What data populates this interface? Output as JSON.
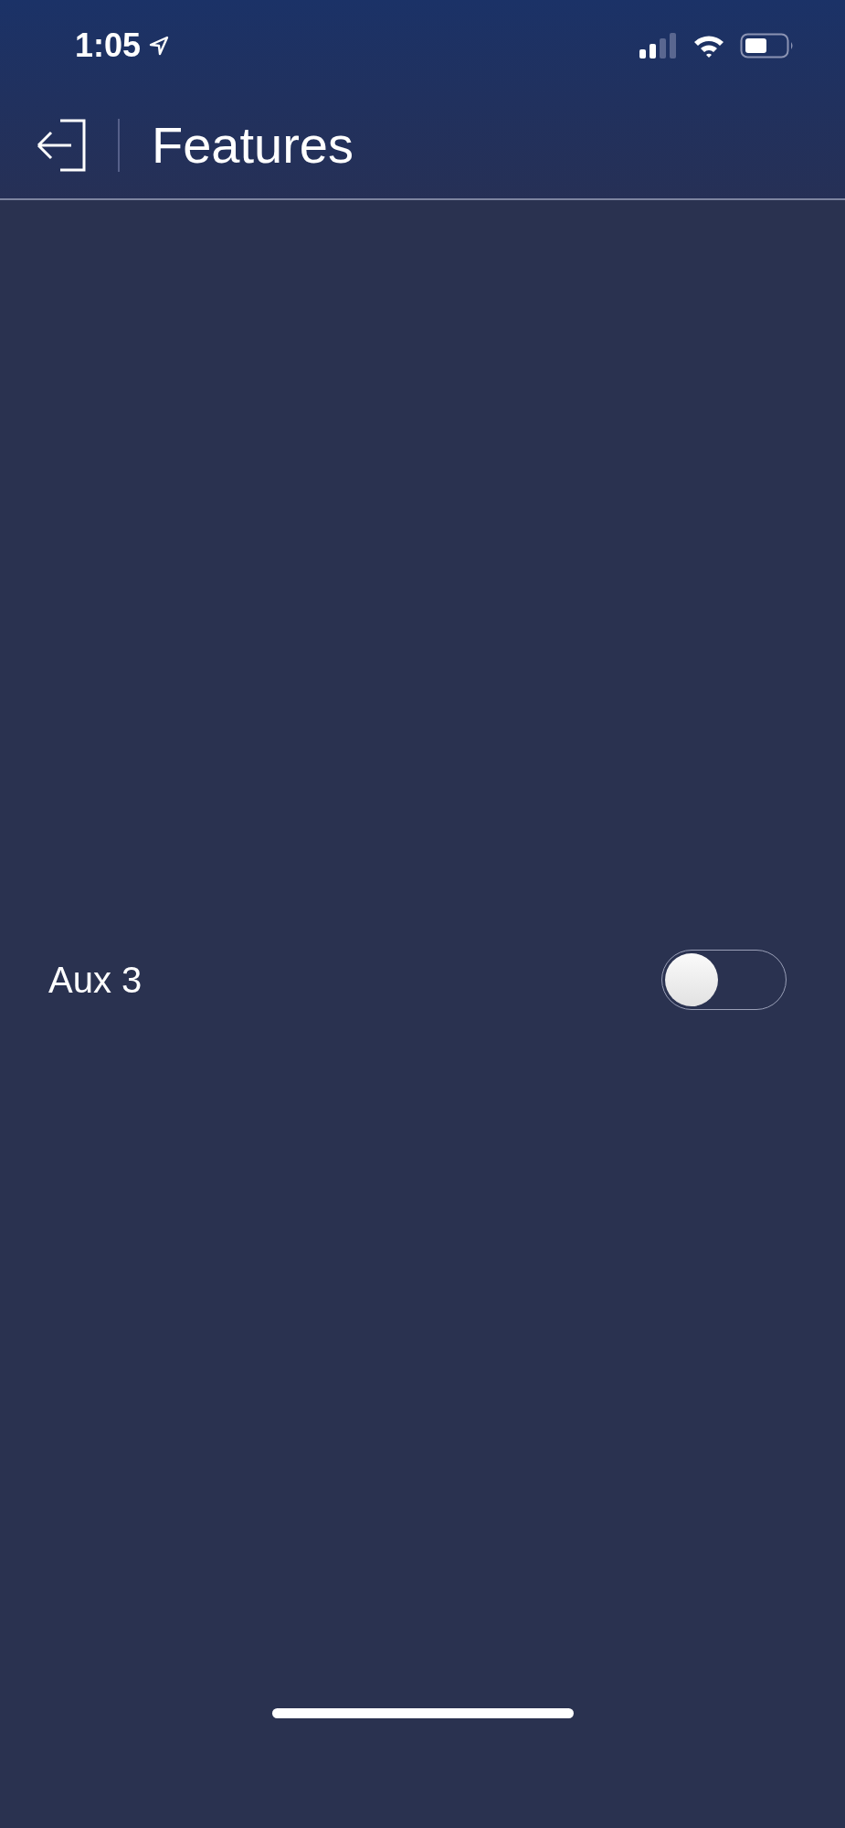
{
  "status_bar": {
    "time": "1:05"
  },
  "header": {
    "title": "Features"
  },
  "features": [
    {
      "label": "Aux 3",
      "on": false
    }
  ]
}
